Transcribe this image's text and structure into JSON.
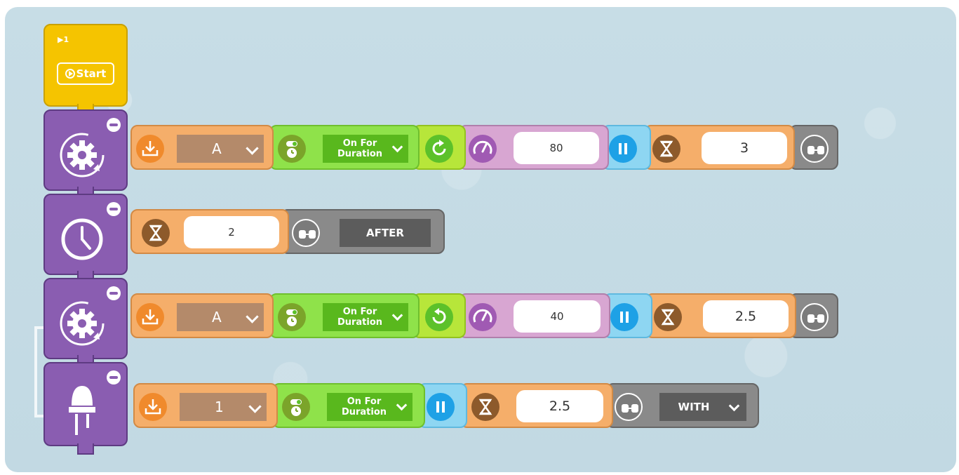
{
  "start": {
    "number": "▶1",
    "label": "Start"
  },
  "row1": {
    "port": "A",
    "mode_line1": "On For",
    "mode_line2": "Duration",
    "speed": "80",
    "duration": "3"
  },
  "row2": {
    "duration": "2",
    "sync": "AFTER"
  },
  "row3": {
    "port": "A",
    "mode_line1": "On For",
    "mode_line2": "Duration",
    "speed": "40",
    "duration": "2.5"
  },
  "row4": {
    "port": "1",
    "mode_line1": "On For",
    "mode_line2": "Duration",
    "duration": "2.5",
    "sync": "WITH"
  },
  "icons": {
    "blocks": [
      "motor-gear-icon",
      "clock-icon",
      "motor-gear-icon",
      "led-icon"
    ],
    "params": [
      "port-download-icon",
      "timer-toggle-icon",
      "direction-clockwise-icon",
      "direction-counterclockwise-icon",
      "speed-gauge-icon",
      "pause-icon",
      "hourglass-icon",
      "sync-link-icon"
    ]
  },
  "colors": {
    "start": "#f5c400",
    "block": "#8a5db1",
    "canvas": "#c7dde6"
  }
}
